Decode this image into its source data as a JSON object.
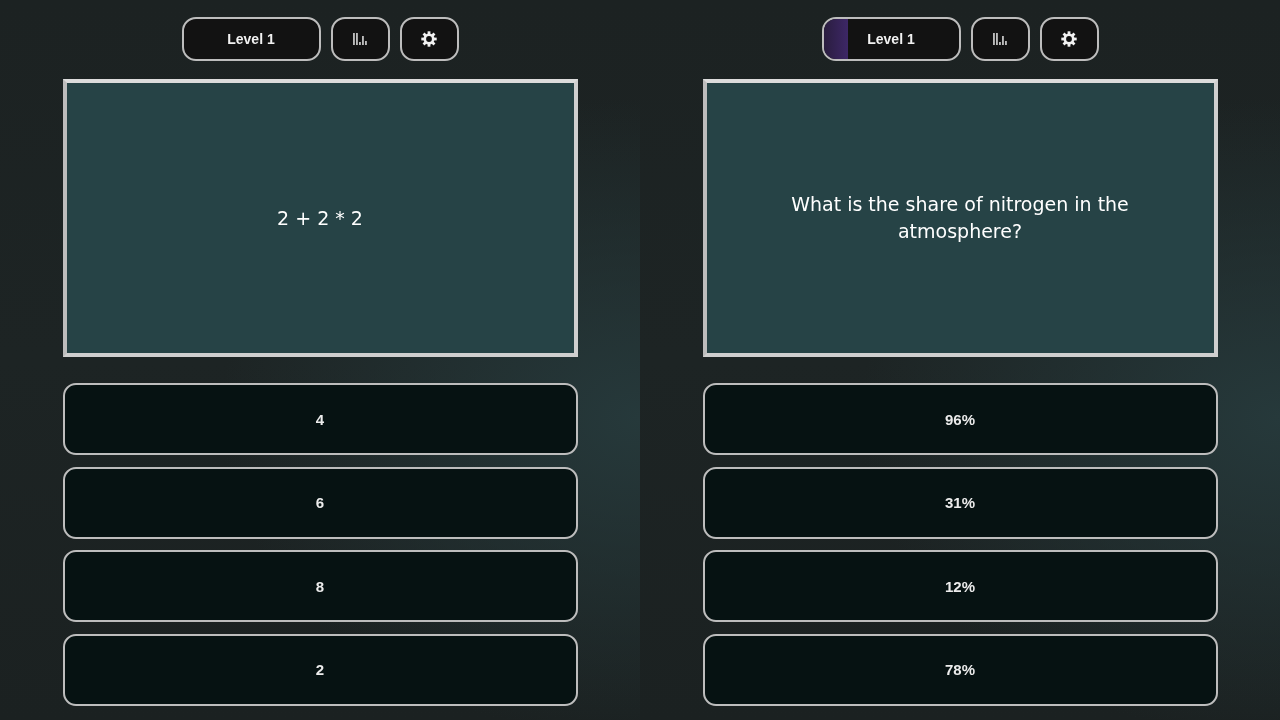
{
  "panels": [
    {
      "level_button": {
        "label": "Level 1"
      },
      "question": "2 + 2 * 2",
      "answers": [
        "4",
        "6",
        "8",
        "2"
      ]
    },
    {
      "level_button": {
        "label": "Level 1",
        "level": 0.18
      },
      "question": "What is the share of nitrogen in the atmosphere?",
      "answers": [
        "96%",
        "31%",
        "12%",
        "78%"
      ]
    }
  ]
}
